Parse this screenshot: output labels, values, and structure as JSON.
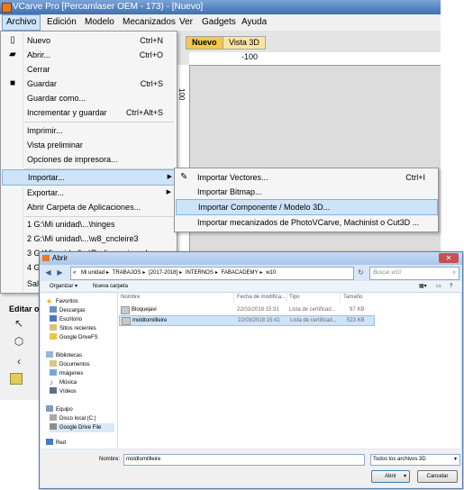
{
  "app": {
    "title": "VCarve Pro [Percamlaser OEM - 173) - [Nuevo]",
    "menus": [
      "Archivo",
      "Edición",
      "Modelo",
      "Mecanizados",
      "Ver",
      "Gadgets",
      "Ayuda"
    ],
    "tabs": [
      "Nuevo",
      "Vista 3D"
    ],
    "ruler_top_label": "-100",
    "ruler_left_label": "100",
    "side_label": "Editar o"
  },
  "file_menu": {
    "items": [
      {
        "label": "Nuevo",
        "shortcut": "Ctrl+N",
        "icon": "new-file-icon"
      },
      {
        "label": "Abrir...",
        "shortcut": "Ctrl+O",
        "icon": "open-folder-icon"
      },
      {
        "label": "Cerrar",
        "shortcut": ""
      },
      {
        "label": "Guardar",
        "shortcut": "Ctrl+S",
        "icon": "save-icon"
      },
      {
        "label": "Guardar como...",
        "shortcut": ""
      },
      {
        "label": "Incrementar y guardar",
        "shortcut": "Ctrl+Alt+S"
      },
      {
        "label": "Imprimir...",
        "shortcut": ""
      },
      {
        "label": "Vista preliminar",
        "shortcut": ""
      },
      {
        "label": "Opciones de impresora...",
        "shortcut": ""
      },
      {
        "label": "Importar...",
        "shortcut": ""
      },
      {
        "label": "Exportar...",
        "shortcut": ""
      },
      {
        "label": "Abrir Carpeta de Aplicaciones...",
        "shortcut": ""
      },
      {
        "label": "1 G:\\Mi unidad\\...\\hinges",
        "shortcut": ""
      },
      {
        "label": "2 G:\\Mi unidad\\...\\w8_cncleire3",
        "shortcut": ""
      },
      {
        "label": "3 G:\\Mi unidad\\...\\Redimensionado",
        "shortcut": ""
      },
      {
        "label": "4 G:\\Mi unidad\\...\\",
        "shortcut": ""
      },
      {
        "label": "Salir",
        "shortcut": ""
      }
    ]
  },
  "import_menu": {
    "items": [
      {
        "label": "Importar Vectores...",
        "shortcut": "Ctrl+I",
        "icon": "import-vectors-icon"
      },
      {
        "label": "Importar Bitmap...",
        "shortcut": ""
      },
      {
        "label": "Importar Componente / Modelo 3D...",
        "shortcut": ""
      },
      {
        "label": "Importar mecanizados de PhotoVCarve, Machinist o Cut3D ...",
        "shortcut": ""
      }
    ]
  },
  "dialog": {
    "title": "Abrir",
    "address": [
      "Mi unidad",
      "TRABAJOS",
      "[2017-2018]",
      "INTERNOS",
      "FABACADEMY",
      "w10"
    ],
    "search_placeholder": "Buscar w10",
    "toolbar": {
      "organize": "Organizar ▾",
      "new_folder": "Nueva carpeta"
    },
    "nav": {
      "favorites": "Favoritos",
      "favorites_items": [
        "Descargas",
        "Escritorio",
        "Sitios recientes",
        "Google DriveFS"
      ],
      "libraries": "Bibliotecas",
      "libraries_items": [
        "Documentos",
        "Imágenes",
        "Música",
        "Vídeos"
      ],
      "computer": "Equipo",
      "computer_items": [
        "Disco local (C:)",
        "Google Drive File"
      ],
      "network": "Red"
    },
    "columns": [
      "Nombre",
      "Fecha de modifica...",
      "Tipo",
      "Tamaño"
    ],
    "files": [
      {
        "name": "Bloquejavi",
        "date": "22/03/2018 15:31",
        "type": "Lista de certificad...",
        "size": "97 KB"
      },
      {
        "name": "moldtomillleire",
        "date": "22/03/2018 15:41",
        "type": "Lista de certificad...",
        "size": "523 KB"
      }
    ],
    "filename_label": "Nombre:",
    "filename_value": "moldtomillleire",
    "filter": "Todos los archivos 3D",
    "open_button": "Abrir",
    "cancel_button": "Cancelar"
  },
  "colors": {
    "menu_highlight": "#cde3f7",
    "tab_active": "#f3c84c",
    "title_bar": "#3f6fb3"
  }
}
